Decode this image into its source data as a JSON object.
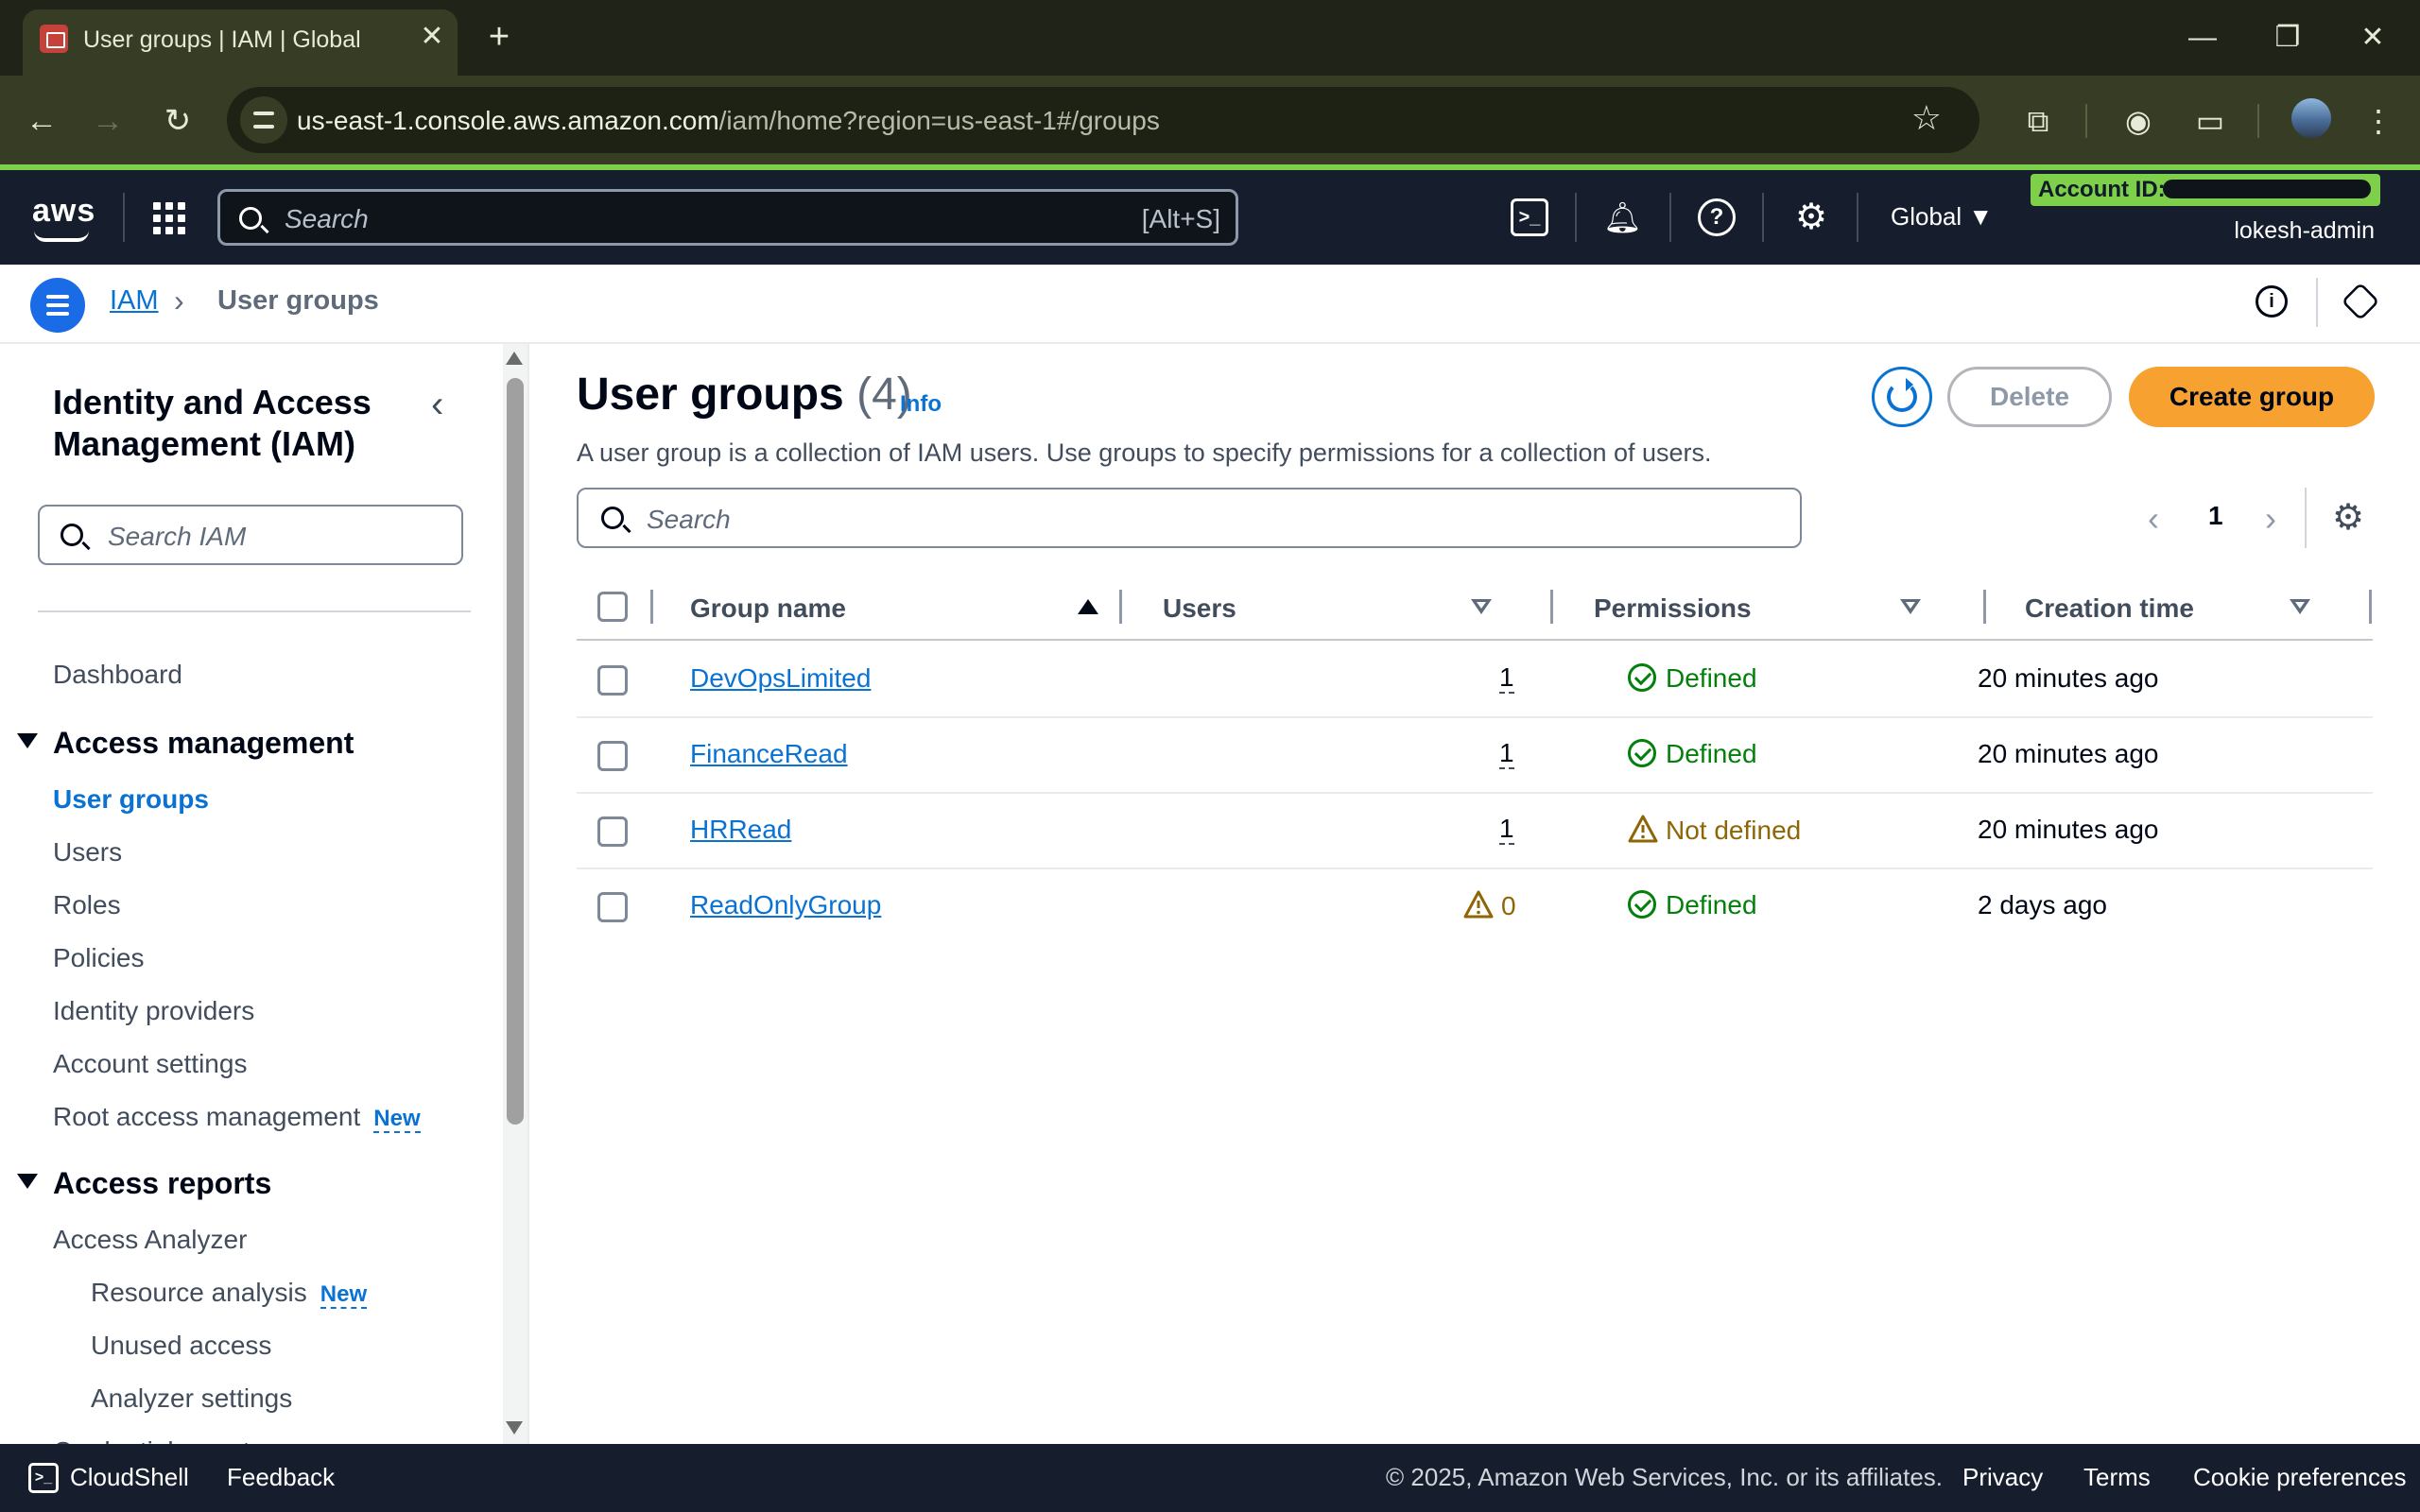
{
  "browser": {
    "tab_title": "User groups | IAM | Global",
    "tab_close": "✕",
    "new_tab": "+",
    "url_host": "us-east-1.console.aws.amazon.com",
    "url_path": "/iam/home?region=us-east-1#/groups"
  },
  "aws_header": {
    "logo": "aws",
    "search_placeholder": "Search",
    "search_shortcut": "[Alt+S]",
    "region": "Global ▼",
    "account_label": "Account ID:",
    "user": "lokesh-admin"
  },
  "breadcrumb": {
    "root": "IAM",
    "separator": "›",
    "current": "User groups"
  },
  "sidenav": {
    "title": "Identity and Access Management (IAM)",
    "search_placeholder": "Search IAM",
    "dashboard": "Dashboard",
    "access_management": {
      "label": "Access management",
      "items": [
        "User groups",
        "Users",
        "Roles",
        "Policies",
        "Identity providers",
        "Account settings",
        "Root access management"
      ]
    },
    "new_badge": "New",
    "access_reports": {
      "label": "Access reports",
      "items": [
        "Access Analyzer",
        "Resource analysis",
        "Unused access",
        "Analyzer settings",
        "Credential report"
      ]
    }
  },
  "main": {
    "title": "User groups",
    "count": "(4)",
    "info": "Info",
    "description": "A user group is a collection of IAM users. Use groups to specify permissions for a collection of users.",
    "delete_label": "Delete",
    "create_label": "Create group",
    "search_placeholder": "Search",
    "page_number": "1",
    "columns": [
      "Group name",
      "Users",
      "Permissions",
      "Creation time"
    ],
    "rows": [
      {
        "name": "DevOpsLimited",
        "users": "1",
        "permissions": "Defined",
        "created": "20 minutes ago"
      },
      {
        "name": "FinanceRead",
        "users": "1",
        "permissions": "Defined",
        "created": "20 minutes ago"
      },
      {
        "name": "HRRead",
        "users": "1",
        "permissions": "Not defined",
        "created": "20 minutes ago"
      },
      {
        "name": "ReadOnlyGroup",
        "users": "0",
        "permissions": "Defined",
        "created": "2 days ago"
      }
    ]
  },
  "footer": {
    "cloudshell": "CloudShell",
    "feedback": "Feedback",
    "copyright": "© 2025, Amazon Web Services, Inc. or its affiliates.",
    "privacy": "Privacy",
    "terms": "Terms",
    "cookies": "Cookie preferences"
  },
  "colors": {
    "accent_blue": "#0972d3",
    "create_orange": "#f7a131",
    "success_green": "#037f0c",
    "warning_brown": "#8d6605",
    "header_navy": "#161e2d"
  }
}
